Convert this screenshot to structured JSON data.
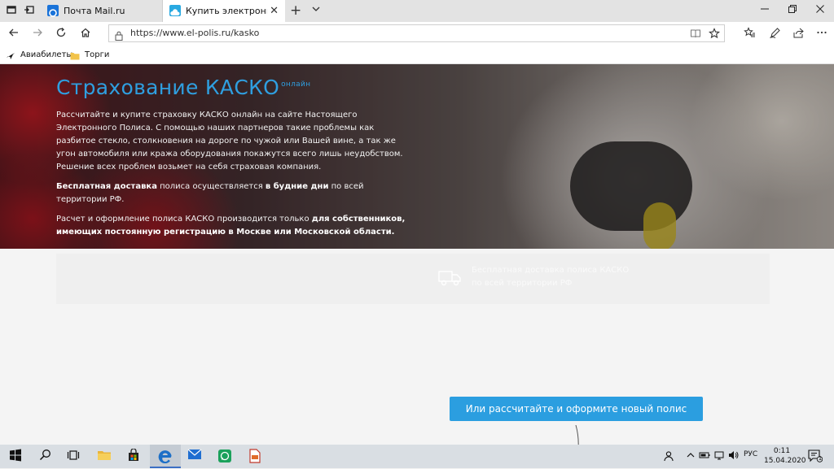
{
  "browser": {
    "tabs": [
      {
        "label": "Почта Mail.ru",
        "active": false
      },
      {
        "label": "Купить электронный п",
        "active": true
      }
    ],
    "address_url": "https://www.el-polis.ru/kasko",
    "favorites": [
      {
        "label": "Авиабилеты",
        "icon": "airplane-icon"
      },
      {
        "label": "Торги",
        "icon": "folder-icon"
      }
    ]
  },
  "hero": {
    "title": "Страхование КАСКО",
    "title_suffix": "онлайн",
    "paragraph1": "Рассчитайте и купите страховку КАСКО онлайн на сайте Настоящего Электронного Полиса. С помощью наших партнеров такие проблемы как разбитое стекло, столкновения на дороге по чужой или Вашей вине, а так же угон автомобиля или кража оборудования покажутся всего лишь неудобством. Решение всех проблем возьмет на себя страховая компания.",
    "paragraph2": {
      "bold1": "Бесплатная доставка",
      "text1": " полиса осуществляется ",
      "bold2": "в будние дни",
      "text2": " по всей территории РФ."
    },
    "paragraph3": {
      "text1": "Расчет и оформление полиса КАСКО производится только ",
      "bold1": "для собственников, имеющих постоянную регистрацию в Москве или Московской области."
    }
  },
  "card": {
    "line1": "Бесплатная доставка полиса КАСКО",
    "line2": "по всей территории РФ"
  },
  "cta": {
    "label": "Или рассчитайте и оформите новый полис"
  },
  "taskbar": {
    "language": "РУС",
    "time": "0:11",
    "date": "15.04.2020",
    "notification_count": "1"
  },
  "colors": {
    "accent": "#2b9ee0",
    "title_blue": "#2f9fe0",
    "taskbar": "#d9dee3"
  }
}
